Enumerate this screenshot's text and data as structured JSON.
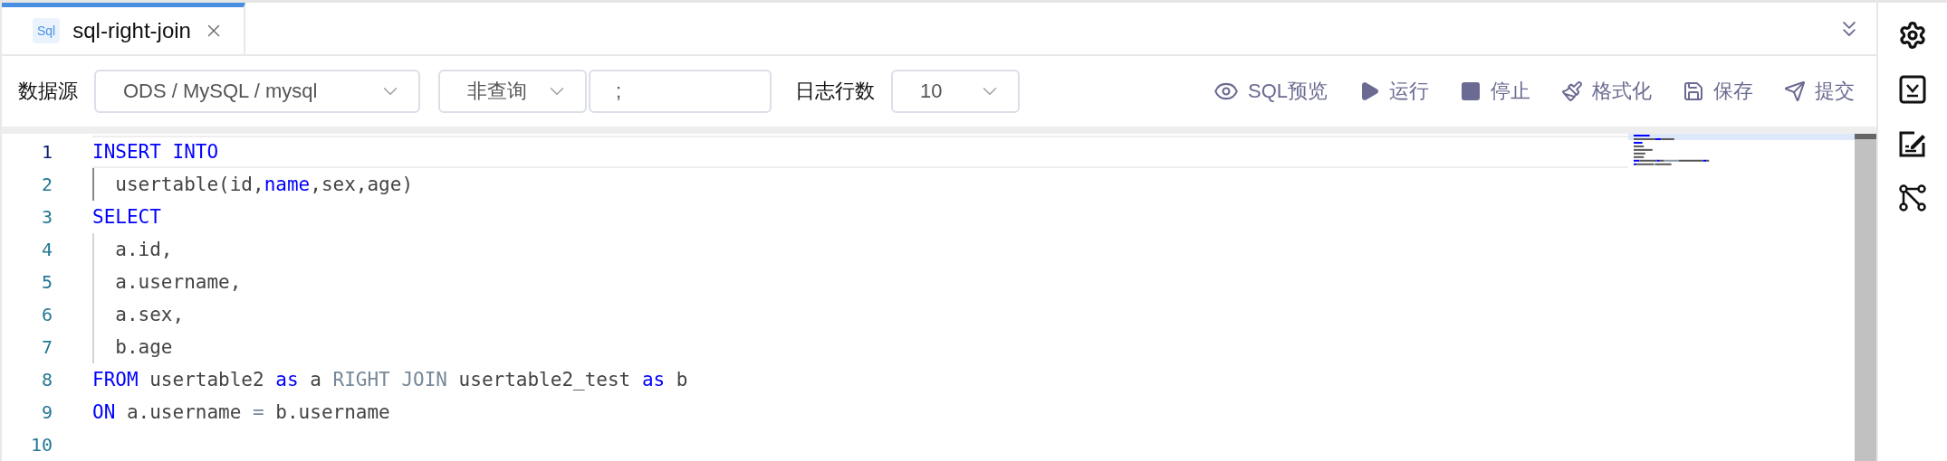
{
  "tabs": [
    {
      "badge": "Sql",
      "label": "sql-right-join",
      "selected": true
    }
  ],
  "toolbar": {
    "datasource_label": "数据源",
    "datasource": "ODS / MySQL / mysql",
    "query_type": "非查询",
    "separator": ";",
    "log_rows_label": "日志行数",
    "log_rows": "10",
    "actions": [
      {
        "kind": "eye",
        "label": "SQL预览"
      },
      {
        "kind": "play",
        "label": "运行"
      },
      {
        "kind": "stop",
        "label": "停止"
      },
      {
        "kind": "brush",
        "label": "格式化"
      },
      {
        "kind": "save",
        "label": "保存"
      },
      {
        "kind": "send",
        "label": "提交"
      }
    ]
  },
  "editor": {
    "lines": [
      {
        "number": "1",
        "current": true,
        "tokens": [
          {
            "kind": "keyword",
            "text": "INSERT INTO"
          }
        ]
      },
      {
        "number": "2",
        "current": false,
        "tokens": [
          {
            "kind": "plain",
            "text": "  usertable(id,"
          },
          {
            "kind": "keyword",
            "text": "name"
          },
          {
            "kind": "plain",
            "text": ",sex,age)"
          }
        ]
      },
      {
        "number": "3",
        "current": false,
        "tokens": [
          {
            "kind": "keyword",
            "text": "SELECT"
          }
        ]
      },
      {
        "number": "4",
        "current": false,
        "tokens": [
          {
            "kind": "plain",
            "text": "  a.id,"
          }
        ]
      },
      {
        "number": "5",
        "current": false,
        "tokens": [
          {
            "kind": "plain",
            "text": "  a.username,"
          }
        ]
      },
      {
        "number": "6",
        "current": false,
        "tokens": [
          {
            "kind": "plain",
            "text": "  a.sex,"
          }
        ]
      },
      {
        "number": "7",
        "current": false,
        "tokens": [
          {
            "kind": "plain",
            "text": "  b.age"
          }
        ]
      },
      {
        "number": "8",
        "current": false,
        "tokens": [
          {
            "kind": "keyword",
            "text": "FROM"
          },
          {
            "kind": "plain",
            "text": " usertable2 "
          },
          {
            "kind": "keyword",
            "text": "as"
          },
          {
            "kind": "plain",
            "text": " a "
          },
          {
            "kind": "muted",
            "text": "RIGHT JOIN"
          },
          {
            "kind": "plain",
            "text": " usertable2_test "
          },
          {
            "kind": "keyword",
            "text": "as"
          },
          {
            "kind": "plain",
            "text": " b"
          }
        ]
      },
      {
        "number": "9",
        "current": false,
        "tokens": [
          {
            "kind": "keyword",
            "text": "ON"
          },
          {
            "kind": "plain",
            "text": " a.username "
          },
          {
            "kind": "muted",
            "text": "="
          },
          {
            "kind": "plain",
            "text": " b.username"
          }
        ]
      },
      {
        "number": "10",
        "current": false
      }
    ]
  },
  "sidebar": {
    "items": [
      {
        "kind": "gear"
      },
      {
        "kind": "download"
      },
      {
        "kind": "edit"
      },
      {
        "kind": "graph"
      }
    ]
  }
}
